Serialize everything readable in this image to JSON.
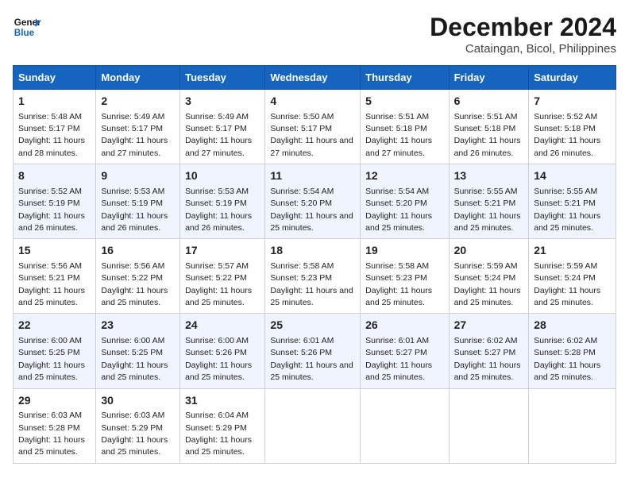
{
  "header": {
    "logo_line1": "General",
    "logo_line2": "Blue",
    "title": "December 2024",
    "subtitle": "Cataingan, Bicol, Philippines"
  },
  "days_of_week": [
    "Sunday",
    "Monday",
    "Tuesday",
    "Wednesday",
    "Thursday",
    "Friday",
    "Saturday"
  ],
  "weeks": [
    [
      {
        "day": 1,
        "rise": "5:48 AM",
        "set": "5:17 PM",
        "daylight": "11 hours and 28 minutes."
      },
      {
        "day": 2,
        "rise": "5:49 AM",
        "set": "5:17 PM",
        "daylight": "11 hours and 27 minutes."
      },
      {
        "day": 3,
        "rise": "5:49 AM",
        "set": "5:17 PM",
        "daylight": "11 hours and 27 minutes."
      },
      {
        "day": 4,
        "rise": "5:50 AM",
        "set": "5:17 PM",
        "daylight": "11 hours and 27 minutes."
      },
      {
        "day": 5,
        "rise": "5:51 AM",
        "set": "5:18 PM",
        "daylight": "11 hours and 27 minutes."
      },
      {
        "day": 6,
        "rise": "5:51 AM",
        "set": "5:18 PM",
        "daylight": "11 hours and 26 minutes."
      },
      {
        "day": 7,
        "rise": "5:52 AM",
        "set": "5:18 PM",
        "daylight": "11 hours and 26 minutes."
      }
    ],
    [
      {
        "day": 8,
        "rise": "5:52 AM",
        "set": "5:19 PM",
        "daylight": "11 hours and 26 minutes."
      },
      {
        "day": 9,
        "rise": "5:53 AM",
        "set": "5:19 PM",
        "daylight": "11 hours and 26 minutes."
      },
      {
        "day": 10,
        "rise": "5:53 AM",
        "set": "5:19 PM",
        "daylight": "11 hours and 26 minutes."
      },
      {
        "day": 11,
        "rise": "5:54 AM",
        "set": "5:20 PM",
        "daylight": "11 hours and 25 minutes."
      },
      {
        "day": 12,
        "rise": "5:54 AM",
        "set": "5:20 PM",
        "daylight": "11 hours and 25 minutes."
      },
      {
        "day": 13,
        "rise": "5:55 AM",
        "set": "5:21 PM",
        "daylight": "11 hours and 25 minutes."
      },
      {
        "day": 14,
        "rise": "5:55 AM",
        "set": "5:21 PM",
        "daylight": "11 hours and 25 minutes."
      }
    ],
    [
      {
        "day": 15,
        "rise": "5:56 AM",
        "set": "5:21 PM",
        "daylight": "11 hours and 25 minutes."
      },
      {
        "day": 16,
        "rise": "5:56 AM",
        "set": "5:22 PM",
        "daylight": "11 hours and 25 minutes."
      },
      {
        "day": 17,
        "rise": "5:57 AM",
        "set": "5:22 PM",
        "daylight": "11 hours and 25 minutes."
      },
      {
        "day": 18,
        "rise": "5:58 AM",
        "set": "5:23 PM",
        "daylight": "11 hours and 25 minutes."
      },
      {
        "day": 19,
        "rise": "5:58 AM",
        "set": "5:23 PM",
        "daylight": "11 hours and 25 minutes."
      },
      {
        "day": 20,
        "rise": "5:59 AM",
        "set": "5:24 PM",
        "daylight": "11 hours and 25 minutes."
      },
      {
        "day": 21,
        "rise": "5:59 AM",
        "set": "5:24 PM",
        "daylight": "11 hours and 25 minutes."
      }
    ],
    [
      {
        "day": 22,
        "rise": "6:00 AM",
        "set": "5:25 PM",
        "daylight": "11 hours and 25 minutes."
      },
      {
        "day": 23,
        "rise": "6:00 AM",
        "set": "5:25 PM",
        "daylight": "11 hours and 25 minutes."
      },
      {
        "day": 24,
        "rise": "6:00 AM",
        "set": "5:26 PM",
        "daylight": "11 hours and 25 minutes."
      },
      {
        "day": 25,
        "rise": "6:01 AM",
        "set": "5:26 PM",
        "daylight": "11 hours and 25 minutes."
      },
      {
        "day": 26,
        "rise": "6:01 AM",
        "set": "5:27 PM",
        "daylight": "11 hours and 25 minutes."
      },
      {
        "day": 27,
        "rise": "6:02 AM",
        "set": "5:27 PM",
        "daylight": "11 hours and 25 minutes."
      },
      {
        "day": 28,
        "rise": "6:02 AM",
        "set": "5:28 PM",
        "daylight": "11 hours and 25 minutes."
      }
    ],
    [
      {
        "day": 29,
        "rise": "6:03 AM",
        "set": "5:28 PM",
        "daylight": "11 hours and 25 minutes."
      },
      {
        "day": 30,
        "rise": "6:03 AM",
        "set": "5:29 PM",
        "daylight": "11 hours and 25 minutes."
      },
      {
        "day": 31,
        "rise": "6:04 AM",
        "set": "5:29 PM",
        "daylight": "11 hours and 25 minutes."
      },
      null,
      null,
      null,
      null
    ]
  ]
}
